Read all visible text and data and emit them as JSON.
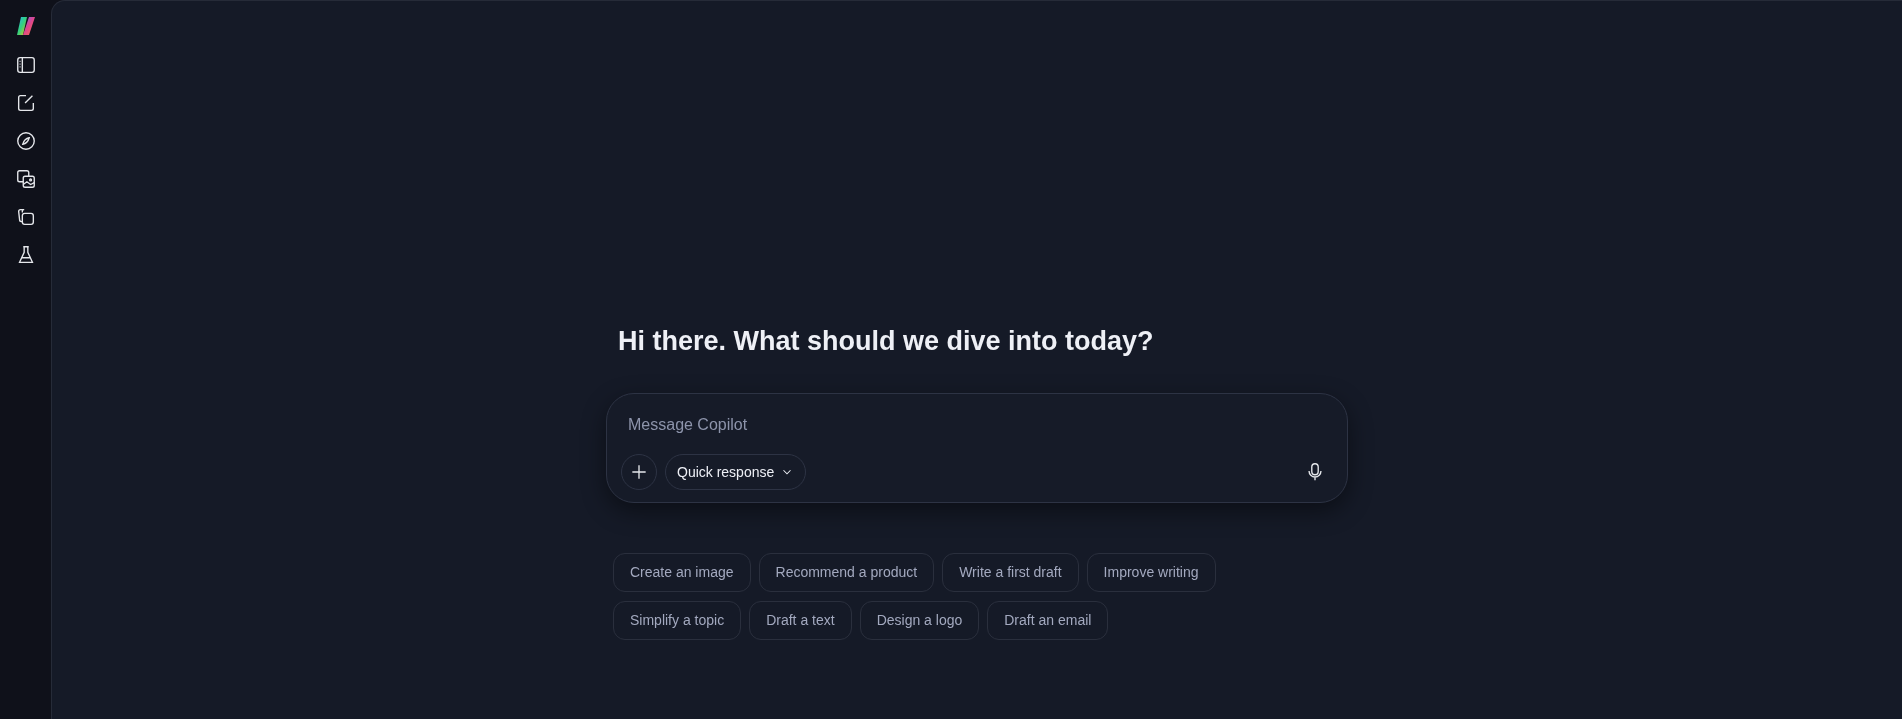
{
  "heading": "Hi there. What should we dive into today?",
  "composer": {
    "placeholder": "Message Copilot",
    "mode": "Quick response"
  },
  "suggestions": [
    [
      "Create an image",
      "Recommend a product",
      "Write a first draft",
      "Improve writing"
    ],
    [
      "Simplify a topic",
      "Draft a text",
      "Design a logo",
      "Draft an email"
    ]
  ]
}
